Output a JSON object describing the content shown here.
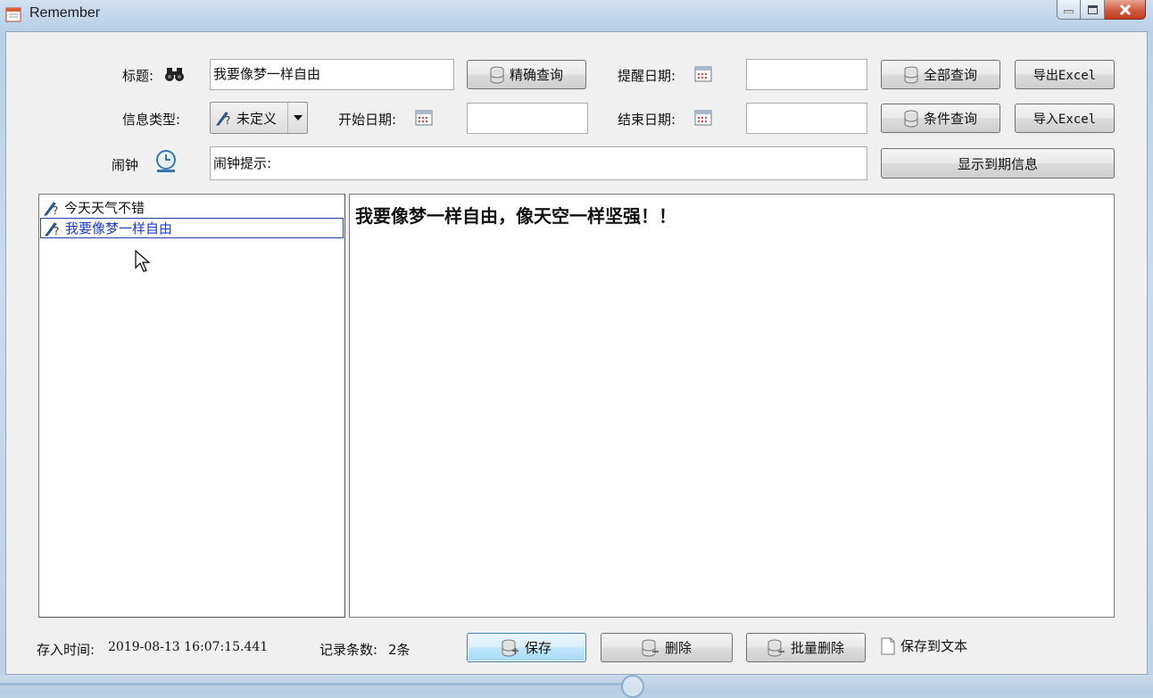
{
  "window": {
    "title": "Remember"
  },
  "form": {
    "title_label": "标题:",
    "title_value": "我要像梦一样自由",
    "exact_query_button": "精确查询",
    "remind_date_label": "提醒日期:",
    "remind_date_value": "",
    "all_query_button": "全部查询",
    "export_excel_button": "导出Excel",
    "info_type_label": "信息类型:",
    "info_type_value": "未定义",
    "start_date_label": "开始日期:",
    "start_date_value": "",
    "end_date_label": "结束日期:",
    "end_date_value": "",
    "condition_query_button": "条件查询",
    "import_excel_button": "导入Excel",
    "alarm_label": "闹钟",
    "alarm_hint": "闹钟提示:",
    "show_expired_button": "显示到期信息"
  },
  "list": {
    "items": [
      {
        "label": "今天天气不错",
        "selected": false
      },
      {
        "label": "我要像梦一样自由",
        "selected": true
      }
    ]
  },
  "editor": {
    "content": "我要像梦一样自由，像天空一样坚强！！"
  },
  "footer": {
    "saved_time_label": "存入时间:",
    "saved_time_value": "2019-08-13 16:07:15.441",
    "record_count_label": "记录条数:",
    "record_count_value": "2条",
    "save_button": "保存",
    "delete_button": "删除",
    "batch_delete_button": "批量删除",
    "save_to_text_label": "保存到文本"
  },
  "colors": {
    "selection_text": "#1a3cc8",
    "close_button": "#c33d20"
  },
  "icons": {
    "title_search": "binoculars-icon",
    "calendar": "calendar-icon",
    "database": "database-icon",
    "alarm": "clock-icon",
    "list_item": "pen-question-icon",
    "text_file": "document-icon"
  }
}
